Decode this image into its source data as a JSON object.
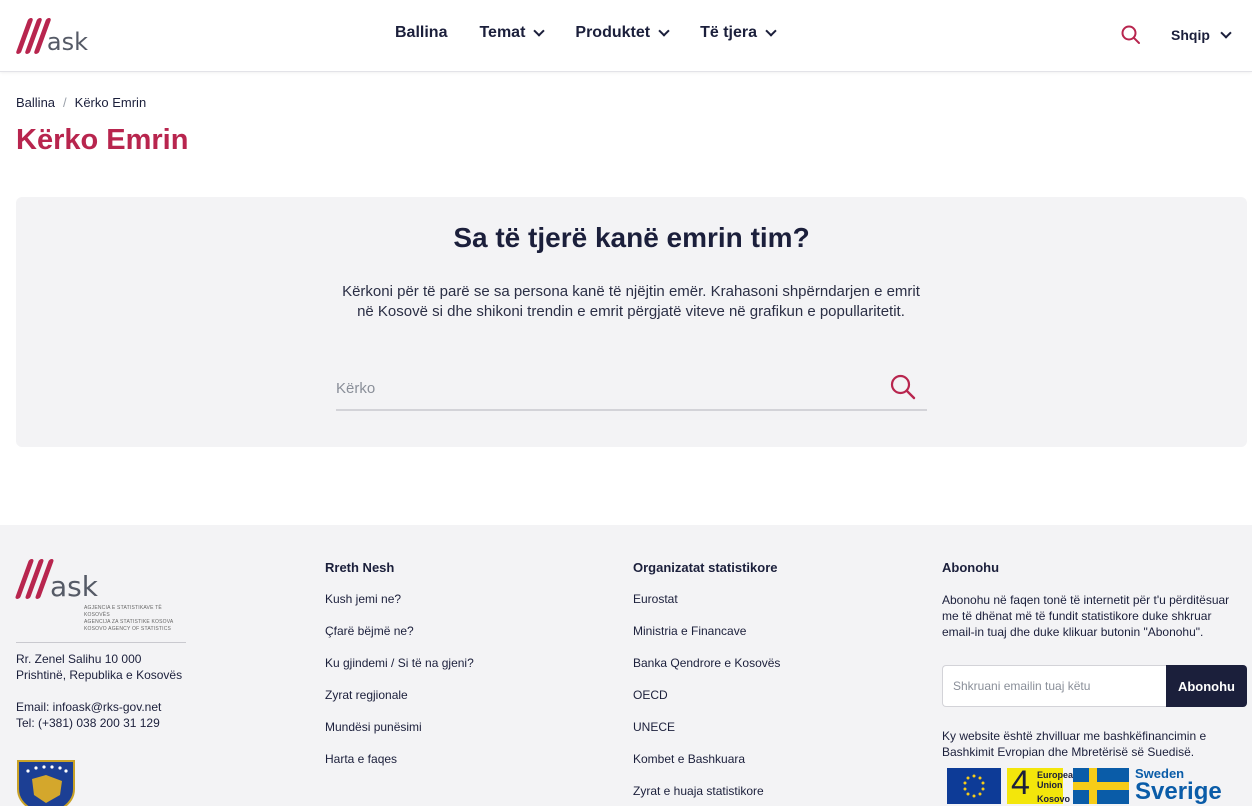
{
  "brand": {
    "logo_text": "ask",
    "accent": "#b8254e",
    "navy": "#1b1f3b"
  },
  "header": {
    "nav": [
      {
        "label": "Ballina",
        "has_dropdown": false
      },
      {
        "label": "Temat",
        "has_dropdown": true
      },
      {
        "label": "Produktet",
        "has_dropdown": true
      },
      {
        "label": "Të tjera",
        "has_dropdown": true
      }
    ],
    "search_icon": "search-icon",
    "language": "Shqip"
  },
  "breadcrumb": {
    "home": "Ballina",
    "separator": "/",
    "current": "Kërko Emrin"
  },
  "page_title": "Kërko Emrin",
  "search_panel": {
    "heading": "Sa të tjerë kanë emrin tim?",
    "description": "Kërkoni për të parë se sa persona kanë të njëjtin emër. Krahasoni shpërndarjen e emrit në Kosovë si dhe shikoni trendin e emrit përgjatë viteve në grafikun e popullaritetit.",
    "placeholder": "Kërko",
    "value": ""
  },
  "footer": {
    "logo_text": "ask",
    "logo_sub": [
      "AGJENCIA E STATISTIKAVE TË KOSOVËS",
      "AGENCIJA ZA STATISTIKE KOSOVA",
      "KOSOVO AGENCY OF STATISTICS"
    ],
    "address_line1": "Rr. Zenel Salihu 10 000",
    "address_line2": "Prishtinë, Republika e Kosovës",
    "email": "Email: infoask@rks-gov.net",
    "tel": "Tel: (+381) 038 200 31 129",
    "about": {
      "title": "Rreth Nesh",
      "links": [
        "Kush jemi ne?",
        "Çfarë bëjmë ne?",
        "Ku gjindemi / Si të na gjeni?",
        "Zyrat regjionale",
        "Mundësi punësimi",
        "Harta e faqes"
      ]
    },
    "orgs": {
      "title": "Organizatat statistikore",
      "links": [
        "Eurostat",
        "Ministria e Financave",
        "Banka Qendrore e Kosovës",
        "OECD",
        "UNECE",
        "Kombet e Bashkuara",
        "Zyrat e huaja statistikore"
      ]
    },
    "subscribe": {
      "title": "Abonohu",
      "text": "Abonohu në faqen tonë të internetit për t'u përditësuar me të dhënat më të fundit statistikore duke shkruar email-in tuaj dhe duke klikuar butonin \"Abonohu\".",
      "placeholder": "Shkruani emailin tuaj këtu",
      "button": "Abonohu",
      "cofinance": "Ky website është zhvilluar me bashkëfinancimin e Bashkimit Evropian dhe Mbretërisë së Suedisë.",
      "eu_label_1": "European",
      "eu_label_2": "Union",
      "eu_label_3": "Kosovo",
      "eu_number": "4",
      "sweden_1": "Sweden",
      "sweden_2": "Sverige"
    }
  }
}
